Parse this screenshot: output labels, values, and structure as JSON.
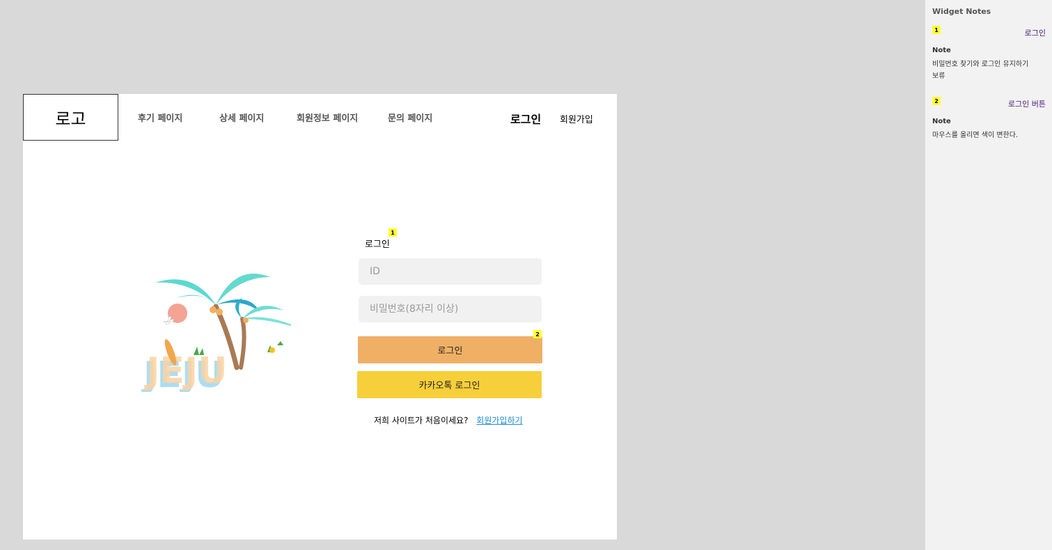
{
  "header": {
    "logo": "로고",
    "nav": [
      "후기 페이지",
      "상세 페이지",
      "회원정보 페이지",
      "문의 페이지"
    ],
    "login": "로그인",
    "signup": "회원가입"
  },
  "illustration": {
    "text": "JEJU"
  },
  "login_form": {
    "title": "로그인",
    "title_marker": "1",
    "id_placeholder": "ID",
    "password_placeholder": "비밀번호(8자리 이상)",
    "login_button": "로그인",
    "login_button_marker": "2",
    "kakao_button": "카카오톡 로그인",
    "signup_prompt": "저희 사이트가 처음이세요?",
    "signup_link": "회원가입하기"
  },
  "widget_notes": {
    "title": "Widget Notes",
    "notes": [
      {
        "number": "1",
        "name": "로그인",
        "label": "Note",
        "text": "비밀번호 찾기와 로그인 유지하기 보류"
      },
      {
        "number": "2",
        "name": "로그인 버튼",
        "label": "Note",
        "text": "마우스를 올리면 색이 변한다."
      }
    ]
  },
  "colors": {
    "login_button": "#efb065",
    "kakao_button": "#f7cf3a",
    "link": "#1c8ad6",
    "marker": "#ffff33",
    "note_name": "#4b1a7a"
  }
}
